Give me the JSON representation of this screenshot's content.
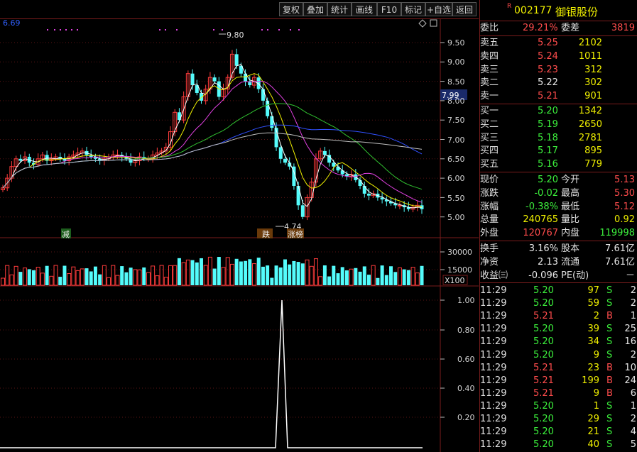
{
  "toolbar": {
    "buttons": [
      "复权",
      "叠加",
      "统计",
      "画线",
      "F10",
      "标记",
      "+自选",
      "返回"
    ]
  },
  "header": {
    "r_badge": "R",
    "code": "002177",
    "name": "御银股份"
  },
  "main_chart": {
    "top_left_value": "6.69",
    "markers": {
      "high": "9.80",
      "low": "4.74",
      "current_price": "7.99"
    },
    "y_ticks": [
      "9.50",
      "9.00",
      "8.50",
      "8.00",
      "7.50",
      "7.00",
      "6.50",
      "6.00",
      "5.50",
      "5.00"
    ],
    "events": [
      "减",
      "跌",
      "涨榜"
    ]
  },
  "volume_chart": {
    "y_ticks": [
      "30000",
      "15000"
    ],
    "unit": "X100"
  },
  "indicator_chart": {
    "y_ticks": [
      "1.00",
      "0.80",
      "0.60",
      "0.40",
      "0.20"
    ]
  },
  "quote": {
    "weibi_label": "委比",
    "weibi": "29.21%",
    "weicha_label": "委差",
    "weicha": "3819",
    "asks": [
      {
        "label": "卖五",
        "price": "5.25",
        "vol": "2102"
      },
      {
        "label": "卖四",
        "price": "5.24",
        "vol": "1011"
      },
      {
        "label": "卖三",
        "price": "5.23",
        "vol": "312"
      },
      {
        "label": "卖二",
        "price": "5.22",
        "vol": "302"
      },
      {
        "label": "卖一",
        "price": "5.21",
        "vol": "901"
      }
    ],
    "bids": [
      {
        "label": "买一",
        "price": "5.20",
        "vol": "1342"
      },
      {
        "label": "买二",
        "price": "5.19",
        "vol": "2650"
      },
      {
        "label": "买三",
        "price": "5.18",
        "vol": "2781"
      },
      {
        "label": "买四",
        "price": "5.17",
        "vol": "895"
      },
      {
        "label": "买五",
        "price": "5.16",
        "vol": "779"
      }
    ],
    "stats": [
      {
        "l1": "现价",
        "v1": "5.20",
        "l2": "今开",
        "v2": "5.13"
      },
      {
        "l1": "涨跌",
        "v1": "-0.02",
        "l2": "最高",
        "v2": "5.30"
      },
      {
        "l1": "涨幅",
        "v1": "-0.38%",
        "l2": "最低",
        "v2": "5.12"
      },
      {
        "l1": "总量",
        "v1": "240765",
        "l2": "量比",
        "v2": "0.92"
      },
      {
        "l1": "外盘",
        "v1": "120767",
        "l2": "内盘",
        "v2": "119998"
      }
    ],
    "extra": [
      {
        "l1": "换手",
        "v1": "3.16%",
        "l2": "股本",
        "v2": "7.61亿"
      },
      {
        "l1": "净资",
        "v1": "2.13",
        "l2": "流通",
        "v2": "7.61亿"
      },
      {
        "l1": "收益㈢",
        "v1": "-0.096",
        "l2": "PE(动)",
        "v2": "－"
      }
    ]
  },
  "ticks": [
    {
      "time": "11:29",
      "price": "5.20",
      "vol": "97",
      "side": "S",
      "num": "2"
    },
    {
      "time": "11:29",
      "price": "5.20",
      "vol": "59",
      "side": "S",
      "num": "2"
    },
    {
      "time": "11:29",
      "price": "5.21",
      "vol": "2",
      "side": "B",
      "num": "1"
    },
    {
      "time": "11:29",
      "price": "5.20",
      "vol": "39",
      "side": "S",
      "num": "25"
    },
    {
      "time": "11:29",
      "price": "5.20",
      "vol": "34",
      "side": "S",
      "num": "16"
    },
    {
      "time": "11:29",
      "price": "5.20",
      "vol": "9",
      "side": "S",
      "num": "2"
    },
    {
      "time": "11:29",
      "price": "5.21",
      "vol": "23",
      "side": "B",
      "num": "10"
    },
    {
      "time": "11:29",
      "price": "5.21",
      "vol": "199",
      "side": "B",
      "num": "24"
    },
    {
      "time": "11:29",
      "price": "5.21",
      "vol": "9",
      "side": "B",
      "num": "6"
    },
    {
      "time": "11:29",
      "price": "5.20",
      "vol": "1",
      "side": "S",
      "num": "1"
    },
    {
      "time": "11:29",
      "price": "5.20",
      "vol": "29",
      "side": "S",
      "num": "2"
    },
    {
      "time": "11:29",
      "price": "5.20",
      "vol": "21",
      "side": "S",
      "num": "4"
    },
    {
      "time": "11:29",
      "price": "5.20",
      "vol": "40",
      "side": "S",
      "num": "5"
    }
  ],
  "colors": {
    "up": "#ff3c3c",
    "down": "#54fcfc",
    "bg": "#000000",
    "grid": "#7a1c1c"
  }
}
